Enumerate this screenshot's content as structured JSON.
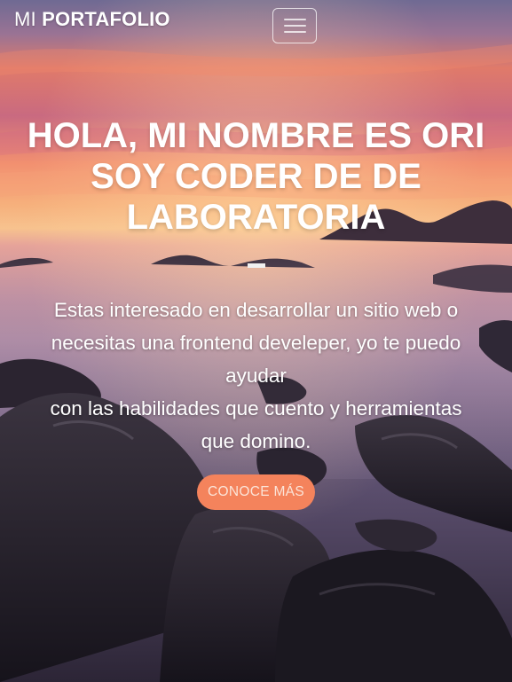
{
  "navbar": {
    "brand_first": "MI",
    "brand_second": "PORTAFOLIO",
    "menu_icon": "hamburger-menu-icon"
  },
  "hero": {
    "headline_lines": [
      "HOLA, MI NOMBRE ES ORI",
      "SOY CODER DE DE",
      "LABORATORIA"
    ],
    "lead_lines": [
      "Estas interesado en desarrollar un sitio web o",
      "necesitas una frontend develeper, yo te puedo",
      "ayudar",
      "con las habilidades que cuento y herramientas",
      "que domino."
    ],
    "cta_label": "CONOCE MÁS"
  },
  "colors": {
    "accent": "#f4835c",
    "text": "#ffffff",
    "sky_top": "#7a6d95",
    "sky_glow": "#f08a6c",
    "rocks": "#1e1b24"
  }
}
